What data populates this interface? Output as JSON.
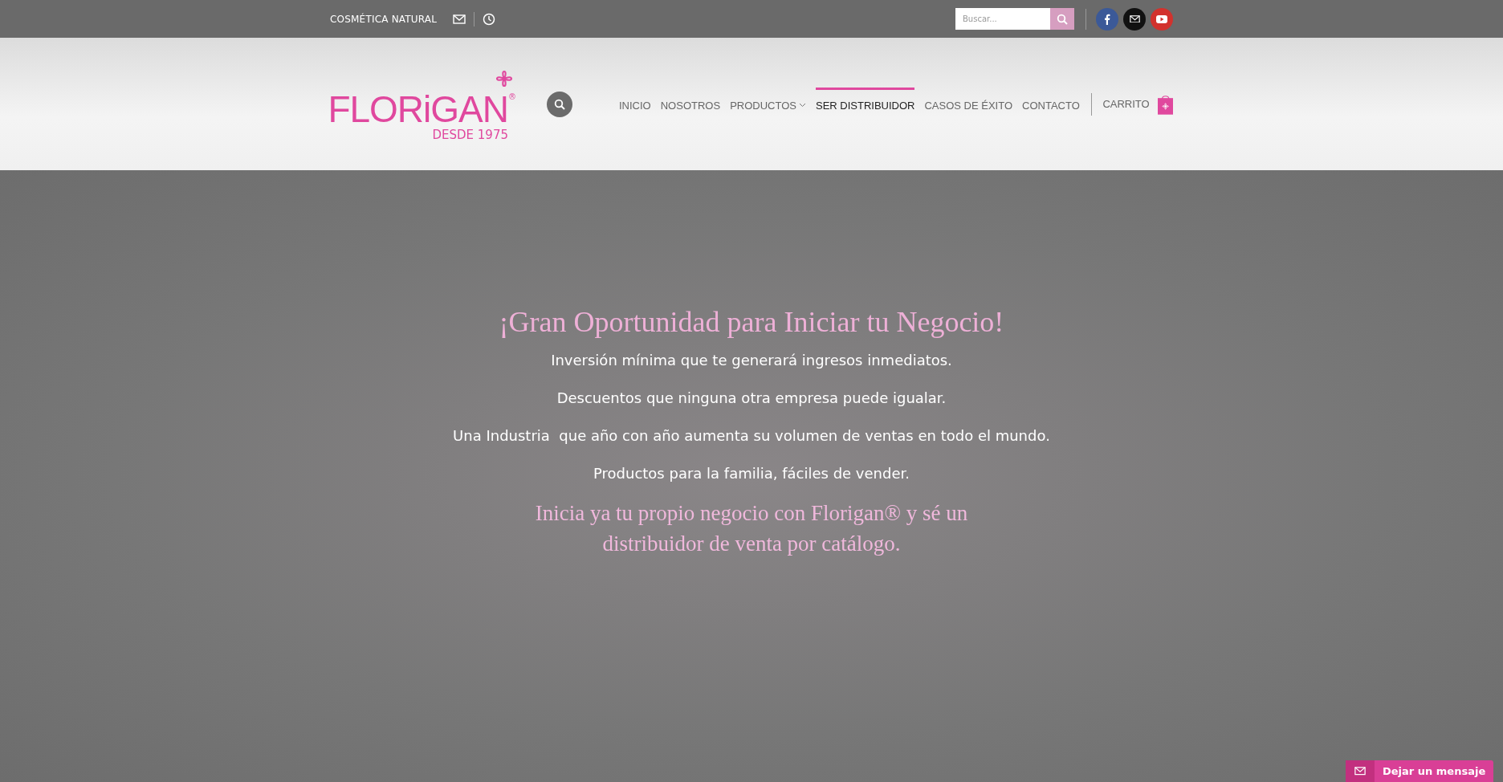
{
  "top_bar": {
    "tagline": "COSMÉTICA NATURAL",
    "search": {
      "placeholder": "Buscar..."
    }
  },
  "header": {
    "logo": {
      "name": "FLORiGAN",
      "mark": "®",
      "subtitle": "DESDE 1975"
    },
    "nav": [
      {
        "label": "INICIO",
        "selected": false,
        "has_dropdown": false
      },
      {
        "label": "NOSOTROS",
        "selected": false,
        "has_dropdown": false
      },
      {
        "label": "PRODUCTOS",
        "selected": false,
        "has_dropdown": true
      },
      {
        "label": "SER DISTRIBUIDOR",
        "selected": true,
        "has_dropdown": false
      },
      {
        "label": "CASOS DE ÉXITO",
        "selected": false,
        "has_dropdown": false
      },
      {
        "label": "CONTACTO",
        "selected": false,
        "has_dropdown": false
      }
    ],
    "cart": {
      "label": "CARRITO"
    }
  },
  "hero": {
    "title": "¡Gran Oportunidad para Iniciar tu Negocio!",
    "lines": [
      "Inversión mínima que te generará ingresos inmediatos.",
      "Descuentos que ninguna otra empresa puede igualar.",
      "Una Industria  que año con año aumenta su volumen de ventas en todo el mundo.",
      "Productos para la familia, fáciles de vender."
    ],
    "closing": "Inicia ya tu propio negocio con Florigan® y sé un distribuidor de venta por catálogo."
  },
  "chat_button": {
    "label": "Dejar un mensaje"
  }
}
